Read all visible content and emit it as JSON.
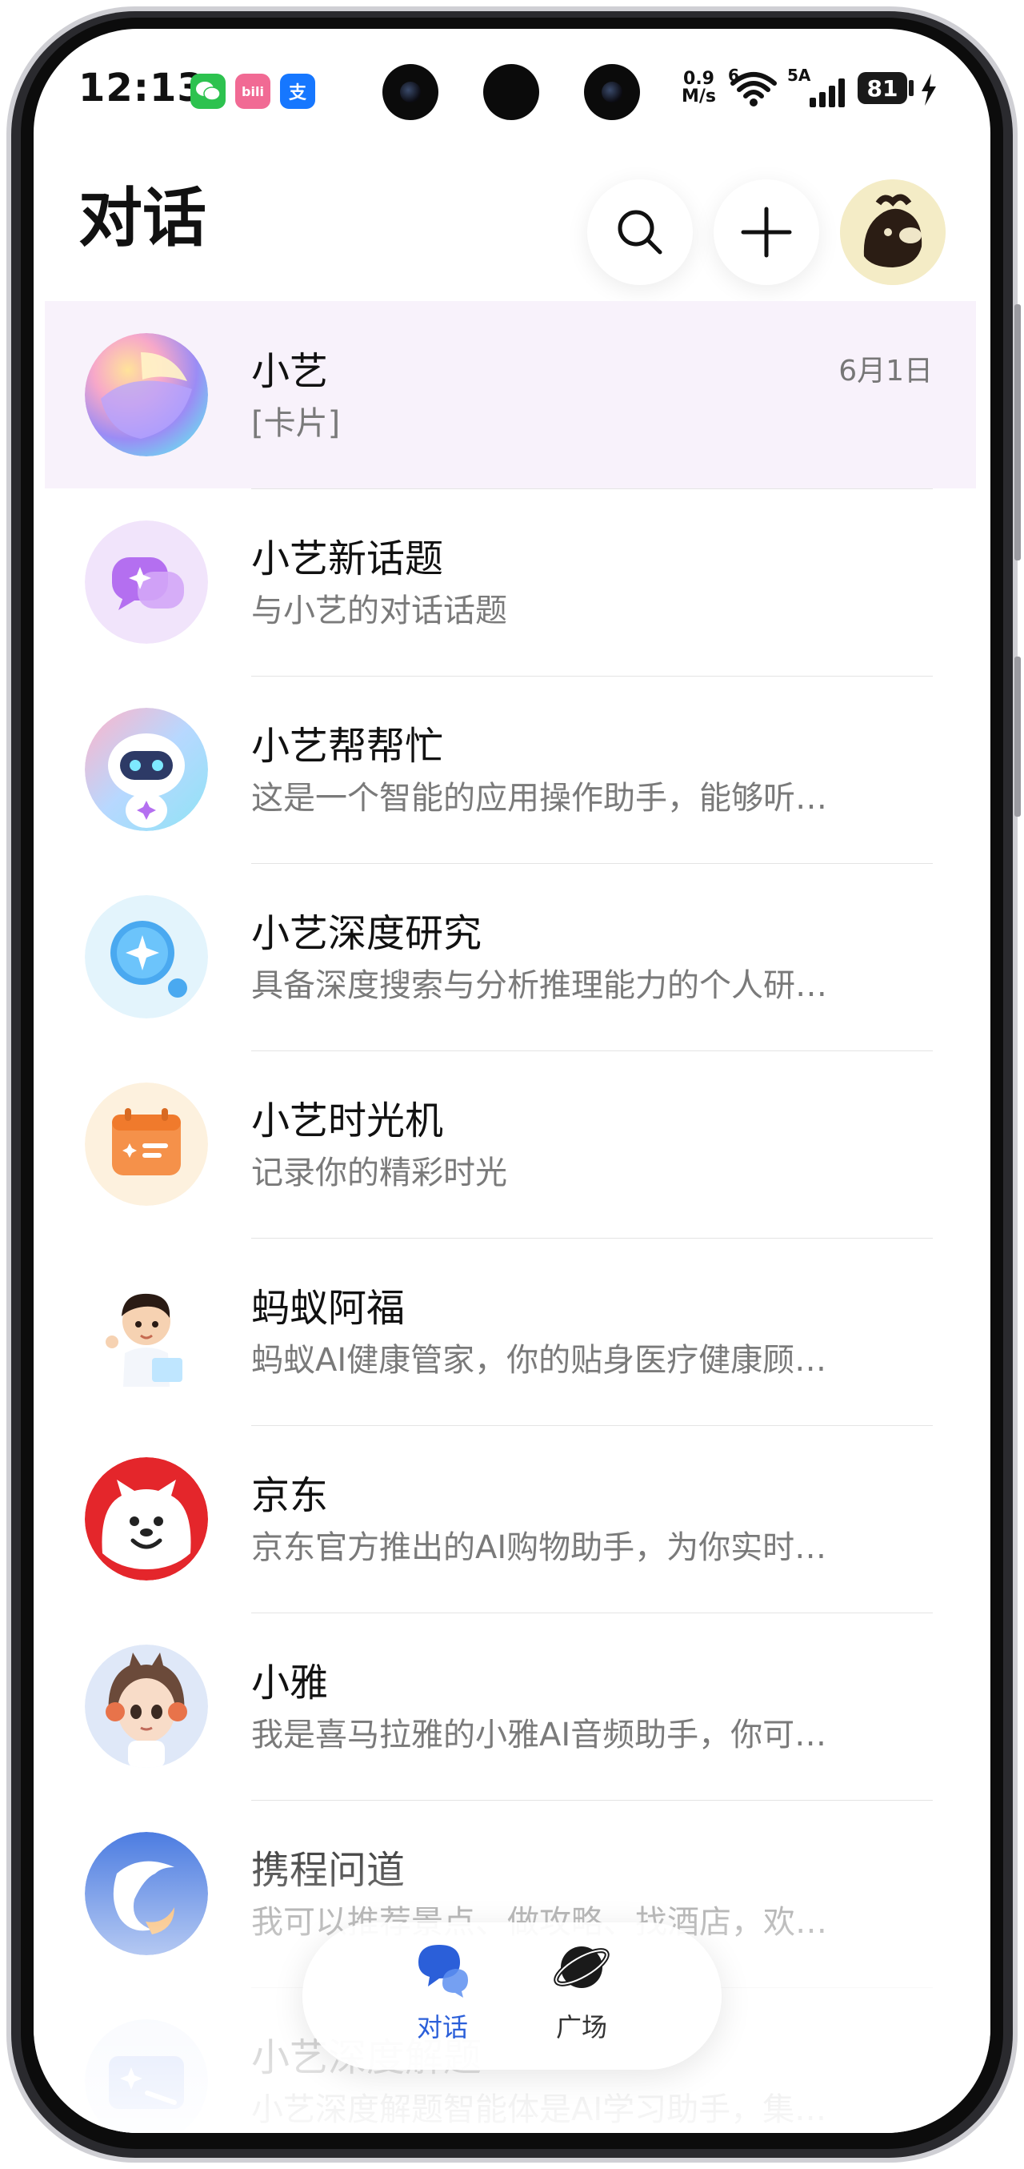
{
  "status_bar": {
    "time": "12:13",
    "apps": [
      "wechat-icon",
      "bilibili-icon",
      "alipay-icon"
    ],
    "net_speed_top": "0.9",
    "net_speed_bottom": "M/s",
    "wifi_tag": "6",
    "signal_tag": "5A",
    "battery": "81"
  },
  "header": {
    "title": "对话"
  },
  "chats": [
    {
      "name": "小艺",
      "preview": "[卡片]",
      "date": "6月1日",
      "icon": "xiaoyi-orb-icon"
    },
    {
      "name": "小艺新话题",
      "preview": "与小艺的对话话题",
      "date": "",
      "icon": "chat-bubble-sparkle-icon"
    },
    {
      "name": "小艺帮帮忙",
      "preview": "这是一个智能的应用操作助手，能够听…",
      "date": "",
      "icon": "robot-icon"
    },
    {
      "name": "小艺深度研究",
      "preview": "具备深度搜索与分析推理能力的个人研…",
      "date": "",
      "icon": "magnifier-sparkle-icon"
    },
    {
      "name": "小艺时光机",
      "preview": "记录你的精彩时光",
      "date": "",
      "icon": "calendar-icon"
    },
    {
      "name": "蚂蚁阿福",
      "preview": "蚂蚁AI健康管家，你的贴身医疗健康顾…",
      "date": "",
      "icon": "doctor-avatar-icon"
    },
    {
      "name": "京东",
      "preview": "京东官方推出的AI购物助手，为你实时…",
      "date": "",
      "icon": "jd-dog-icon"
    },
    {
      "name": "小雅",
      "preview": "我是喜马拉雅的小雅AI音频助手，你可…",
      "date": "",
      "icon": "xiaoya-avatar-icon"
    },
    {
      "name": "携程问道",
      "preview": "我可以推荐景点、做攻略、找酒店，欢…",
      "date": "",
      "icon": "ctrip-dolphin-icon"
    },
    {
      "name": "小艺深度解题",
      "preview": "小艺深度解题智能体是AI学习助手，集…",
      "date": "",
      "icon": "problem-solving-icon"
    }
  ],
  "bottom_nav": {
    "items": [
      {
        "label": "对话",
        "active": true,
        "icon": "chat-bubbles-icon"
      },
      {
        "label": "广场",
        "active": false,
        "icon": "planet-icon"
      }
    ]
  },
  "colors": {
    "accent": "#2b5fd9",
    "active_row_bg": "#f8f2fb",
    "text_primary": "#111111",
    "text_secondary": "#7a7a7a"
  }
}
